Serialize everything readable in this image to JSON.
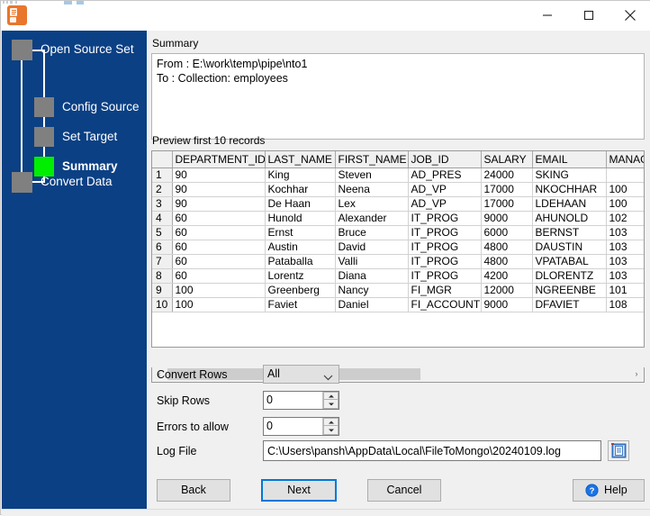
{
  "window": {
    "title": "",
    "icon": "filetomongo-app-icon",
    "controls": {
      "minimize": "minimize-icon",
      "maximize": "maximize-icon",
      "close": "close-icon"
    }
  },
  "sidebar": {
    "steps": [
      {
        "label": "Open Source Set",
        "state": "done"
      },
      {
        "label": "Config Source",
        "state": "done"
      },
      {
        "label": "Set Target",
        "state": "done"
      },
      {
        "label": "Summary",
        "state": "active"
      },
      {
        "label": "Convert Data",
        "state": "pending"
      }
    ],
    "background_color": "#0b4084",
    "active_color": "#00ee00",
    "step_color": "#808080"
  },
  "summary": {
    "group_label": "Summary",
    "lines": [
      "From : E:\\work\\temp\\pipe\\nto1",
      "To : Collection: employees"
    ]
  },
  "preview": {
    "group_label": "Preview first 10 records",
    "columns": [
      "",
      "DEPARTMENT_ID",
      "LAST_NAME",
      "FIRST_NAME",
      "JOB_ID",
      "SALARY",
      "EMAIL",
      "MANAG"
    ],
    "rows": [
      [
        "1",
        "90",
        "King",
        "Steven",
        "AD_PRES",
        "24000",
        "SKING",
        ""
      ],
      [
        "2",
        "90",
        "Kochhar",
        "Neena",
        "AD_VP",
        "17000",
        "NKOCHHAR",
        "100"
      ],
      [
        "3",
        "90",
        "De Haan",
        "Lex",
        "AD_VP",
        "17000",
        "LDEHAAN",
        "100"
      ],
      [
        "4",
        "60",
        "Hunold",
        "Alexander",
        "IT_PROG",
        "9000",
        "AHUNOLD",
        "102"
      ],
      [
        "5",
        "60",
        "Ernst",
        "Bruce",
        "IT_PROG",
        "6000",
        "BERNST",
        "103"
      ],
      [
        "6",
        "60",
        "Austin",
        "David",
        "IT_PROG",
        "4800",
        "DAUSTIN",
        "103"
      ],
      [
        "7",
        "60",
        "Pataballa",
        "Valli",
        "IT_PROG",
        "4800",
        "VPATABAL",
        "103"
      ],
      [
        "8",
        "60",
        "Lorentz",
        "Diana",
        "IT_PROG",
        "4200",
        "DLORENTZ",
        "103"
      ],
      [
        "9",
        "100",
        "Greenberg",
        "Nancy",
        "FI_MGR",
        "12000",
        "NGREENBE",
        "101"
      ],
      [
        "10",
        "100",
        "Faviet",
        "Daniel",
        "FI_ACCOUNT",
        "9000",
        "DFAVIET",
        "108"
      ]
    ],
    "scrollbar": {
      "left_arrow": "‹",
      "right_arrow": "›"
    }
  },
  "options": {
    "convert_rows": {
      "label": "Convert Rows",
      "value": "All"
    },
    "skip_rows": {
      "label": "Skip Rows",
      "value": "0"
    },
    "errors_to_allow": {
      "label": "Errors to allow",
      "value": "0"
    },
    "log_file": {
      "label": "Log File",
      "value": "C:\\Users\\pansh\\AppData\\Local\\FileToMongo\\20240109.log",
      "browse_icon": "document-browse-icon"
    }
  },
  "footer": {
    "back": "Back",
    "next": "Next",
    "cancel": "Cancel",
    "help": "Help",
    "help_icon": "question-mark-icon"
  }
}
